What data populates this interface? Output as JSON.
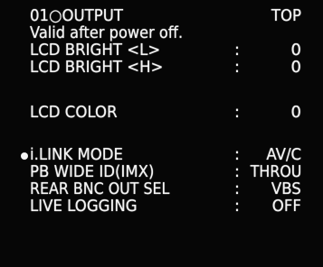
{
  "menu": {
    "header": {
      "page": "01○OUTPUT",
      "position": "TOP",
      "note": "Valid after power off."
    },
    "items": [
      {
        "label": "LCD BRIGHT <L>",
        "sep": ":",
        "value": "0"
      },
      {
        "label": "LCD BRIGHT <H>",
        "sep": ":",
        "value": "0"
      },
      {
        "label": "LCD COLOR",
        "sep": ":",
        "value": "0"
      },
      {
        "label": "i.LINK MODE",
        "sep": ":",
        "value": "AV/C",
        "selected": true
      },
      {
        "label": "PB WIDE ID(IMX)",
        "sep": ":",
        "value": "THROU"
      },
      {
        "label": "REAR BNC OUT SEL",
        "sep": ":",
        "value": "VBS"
      },
      {
        "label": "LIVE LOGGING",
        "sep": ":",
        "value": "OFF"
      }
    ]
  },
  "colors": {
    "background": "#060606",
    "text": "#f4f4f4"
  }
}
